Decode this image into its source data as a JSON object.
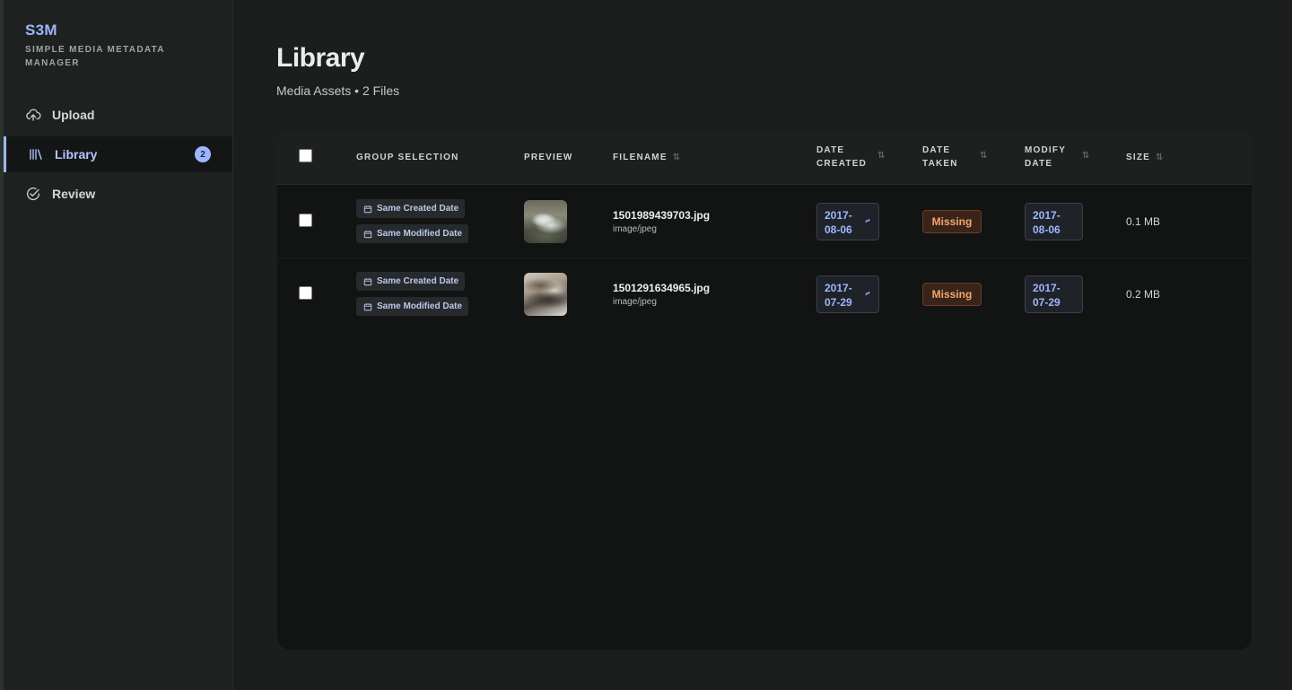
{
  "app": {
    "brand_title": "S3M",
    "brand_subtitle": "SIMPLE MEDIA METADATA MANAGER"
  },
  "sidebar": {
    "items": [
      {
        "label": "Upload",
        "icon": "cloud-upload-icon",
        "active": false
      },
      {
        "label": "Library",
        "icon": "library-icon",
        "active": true,
        "badge": "2"
      },
      {
        "label": "Review",
        "icon": "check-circle-icon",
        "active": false
      }
    ]
  },
  "page": {
    "title": "Library",
    "subtitle": "Media Assets • 2 Files"
  },
  "table": {
    "columns": {
      "group_selection": "GROUP SELECTION",
      "preview": "PREVIEW",
      "filename": "FILENAME",
      "date_created_1": "DATE",
      "date_created_2": "CREATED",
      "date_taken_1": "DATE",
      "date_taken_2": "TAKEN",
      "modify_date_1": "MODIFY",
      "modify_date_2": "DATE",
      "size": "SIZE",
      "sort_glyph": "⇅"
    },
    "rows": [
      {
        "group_chips": [
          "Same Created Date",
          "Same Modified Date"
        ],
        "filename": "1501989439703.jpg",
        "mime": "image/jpeg",
        "date_created_1": "2017-",
        "date_created_2": "08-06",
        "date_taken": "Missing",
        "modify_date_1": "2017-",
        "modify_date_2": "08-06",
        "size": "0.1 MB"
      },
      {
        "group_chips": [
          "Same Created Date",
          "Same Modified Date"
        ],
        "filename": "1501291634965.jpg",
        "mime": "image/jpeg",
        "date_created_1": "2017-",
        "date_created_2": "07-29",
        "date_taken": "Missing",
        "modify_date_1": "2017-",
        "modify_date_2": "07-29",
        "size": "0.2 MB"
      }
    ]
  },
  "colors": {
    "accent": "#9db7ff",
    "missing_text": "#f2a66f",
    "background": "#1c1e1e",
    "table_bg": "#121313"
  }
}
